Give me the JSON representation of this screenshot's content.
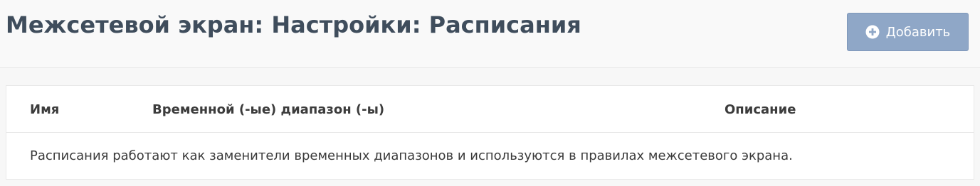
{
  "header": {
    "title": "Межсетевой экран: Настройки: Расписания",
    "add_button_label": "Добавить",
    "add_button_icon": "plus-circle-icon"
  },
  "table": {
    "columns": [
      {
        "label": "Имя"
      },
      {
        "label": "Временной (-ые) диапазон (-ы)"
      },
      {
        "label": "Описание"
      }
    ],
    "info_text": "Расписания работают как заменители временных диапазонов и используются в правилах межсетевого экрана."
  },
  "colors": {
    "title": "#3f4d5c",
    "button_bg": "#8fa7c7",
    "button_text": "#ffffff"
  }
}
